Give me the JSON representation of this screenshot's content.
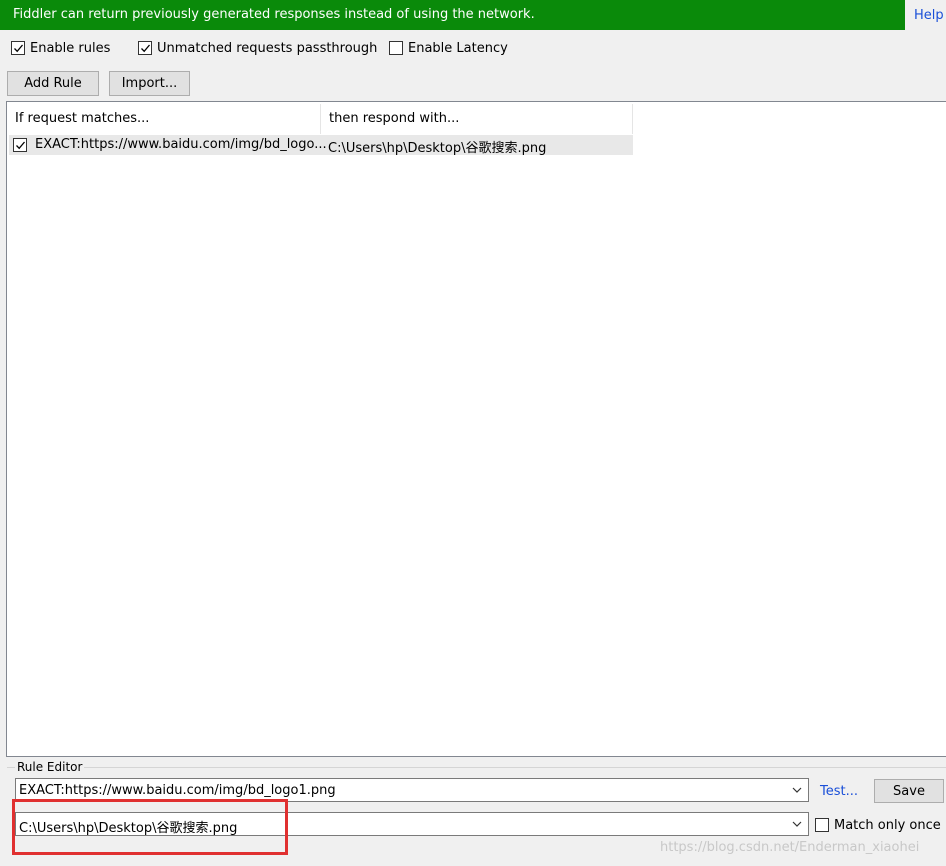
{
  "banner": {
    "message": "Fiddler can return previously generated responses instead of using the network.",
    "help_label": "Help"
  },
  "options": {
    "enable_rules": {
      "label": "Enable rules",
      "checked": true
    },
    "unmatched_passthrough": {
      "label": "Unmatched requests passthrough",
      "checked": true
    },
    "enable_latency": {
      "label": "Enable Latency",
      "checked": false
    }
  },
  "toolbar": {
    "add_rule_label": "Add Rule",
    "import_label": "Import..."
  },
  "rules_table": {
    "columns": [
      "If request matches...",
      "then respond with..."
    ],
    "rows": [
      {
        "checked": true,
        "match": "EXACT:https://www.baidu.com/img/bd_logo...",
        "respond": "C:\\Users\\hp\\Desktop\\谷歌搜索.png"
      }
    ]
  },
  "rule_editor": {
    "group_label": "Rule Editor",
    "match_value": "EXACT:https://www.baidu.com/img/bd_logo1.png",
    "respond_value": "C:\\Users\\hp\\Desktop\\谷歌搜索.png",
    "test_label": "Test...",
    "save_label": "Save",
    "match_once_label": "Match only once",
    "match_once_checked": false
  },
  "watermark": "https://blog.csdn.net/Enderman_xiaohei",
  "colors": {
    "banner_bg": "#0a8a0a",
    "link": "#1a4fd8",
    "highlight_box": "#e03030"
  }
}
